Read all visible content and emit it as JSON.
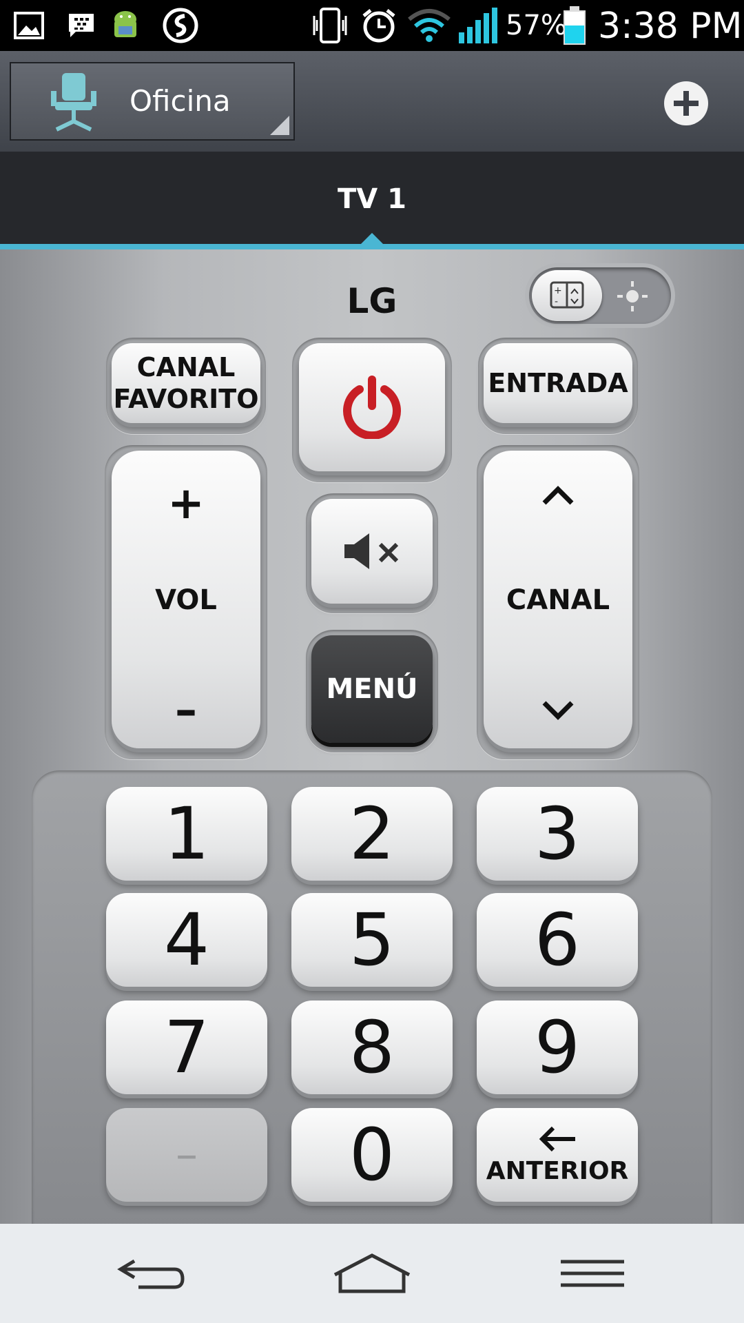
{
  "status_bar": {
    "icons": [
      "gallery-icon",
      "bbm-icon",
      "android-icon",
      "app-icon",
      "vibrate-icon",
      "alarm-icon",
      "wifi-icon",
      "signal-icon",
      "battery-icon"
    ],
    "battery_percent": "57%",
    "time": "3:38 PM"
  },
  "header": {
    "room_name": "Oficina",
    "room_icon": "office-chair-icon",
    "add_icon": "plus-icon"
  },
  "tabs": [
    {
      "label": "TV 1",
      "selected": true
    }
  ],
  "remote": {
    "brand": "LG",
    "mode_toggle": {
      "left_icon": "remote-layout-icon",
      "right_icon": "brightness-icon"
    },
    "favorite_channel": {
      "line1": "CANAL",
      "line2": "FAVORITO"
    },
    "power_icon": "power-icon",
    "input_label": "ENTRADA",
    "volume": {
      "plus": "+",
      "label": "VOL",
      "minus": "–"
    },
    "mute_icon": "mute-icon",
    "menu_label": "MENÚ",
    "channel": {
      "label": "CANAL",
      "up_icon": "chevron-up-icon",
      "down_icon": "chevron-down-icon"
    },
    "numpad": {
      "keys": [
        "1",
        "2",
        "3",
        "4",
        "5",
        "6",
        "7",
        "8",
        "9",
        "–",
        "0"
      ],
      "previous_label": "ANTERIOR",
      "previous_icon": "arrow-left-icon"
    }
  },
  "nav_bar": {
    "back_icon": "back-icon",
    "home_icon": "home-icon",
    "menu_icon": "menu-icon"
  },
  "colors": {
    "accent": "#4ab6d3",
    "power_red": "#d3262b",
    "chair_teal": "#7fcad3"
  }
}
